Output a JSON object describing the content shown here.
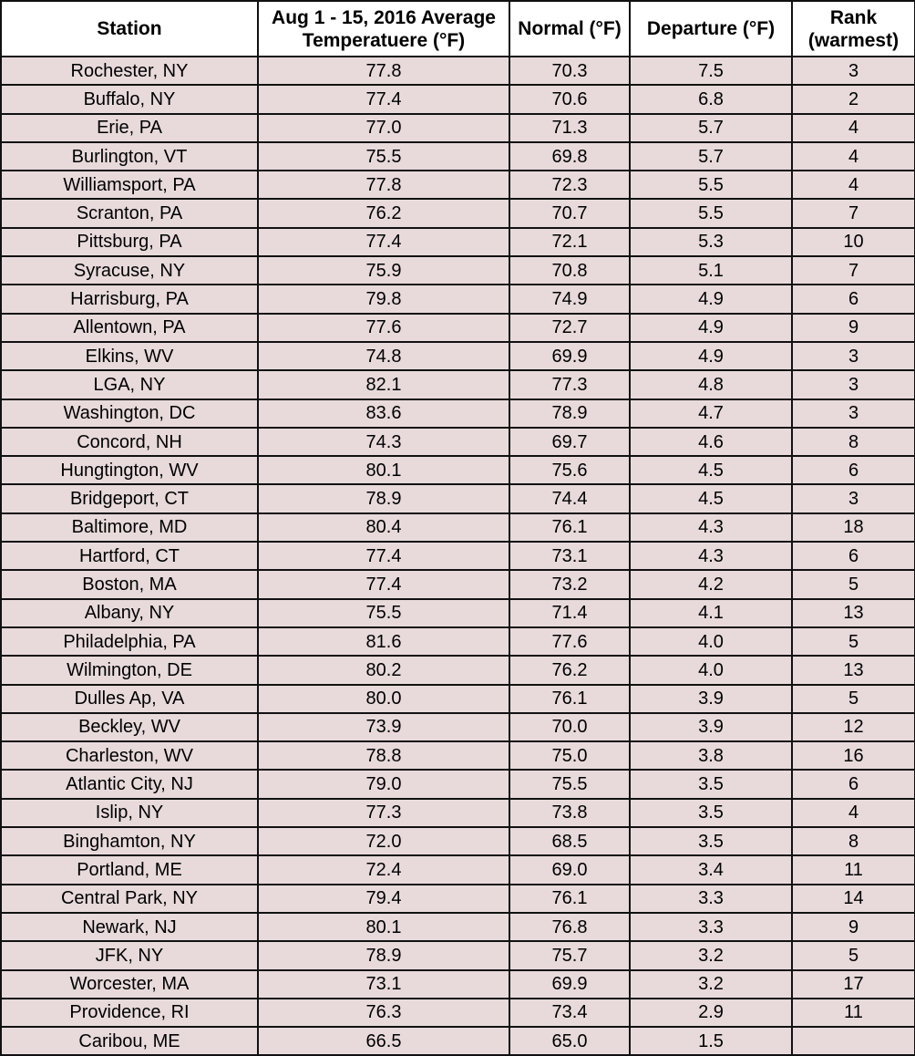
{
  "table": {
    "headers": [
      "Station",
      "Aug 1 - 15, 2016 Average Temperatuere (°F)",
      "Normal (°F)",
      "Departure (°F)",
      "Rank (warmest)"
    ],
    "header_lines": [
      [
        "Station"
      ],
      [
        "Aug 1 - 15, 2016 Average",
        "Temperatuere (°F)"
      ],
      [
        "Normal (°F)"
      ],
      [
        "Departure (°F)"
      ],
      [
        "Rank",
        "(warmest)"
      ]
    ],
    "rows": [
      [
        "Rochester, NY",
        "77.8",
        "70.3",
        "7.5",
        "3"
      ],
      [
        "Buffalo, NY",
        "77.4",
        "70.6",
        "6.8",
        "2"
      ],
      [
        "Erie, PA",
        "77.0",
        "71.3",
        "5.7",
        "4"
      ],
      [
        "Burlington, VT",
        "75.5",
        "69.8",
        "5.7",
        "4"
      ],
      [
        "Williamsport, PA",
        "77.8",
        "72.3",
        "5.5",
        "4"
      ],
      [
        "Scranton, PA",
        "76.2",
        "70.7",
        "5.5",
        "7"
      ],
      [
        "Pittsburg, PA",
        "77.4",
        "72.1",
        "5.3",
        "10"
      ],
      [
        "Syracuse, NY",
        "75.9",
        "70.8",
        "5.1",
        "7"
      ],
      [
        "Harrisburg, PA",
        "79.8",
        "74.9",
        "4.9",
        "6"
      ],
      [
        "Allentown, PA",
        "77.6",
        "72.7",
        "4.9",
        "9"
      ],
      [
        "Elkins, WV",
        "74.8",
        "69.9",
        "4.9",
        "3"
      ],
      [
        "LGA, NY",
        "82.1",
        "77.3",
        "4.8",
        "3"
      ],
      [
        "Washington, DC",
        "83.6",
        "78.9",
        "4.7",
        "3"
      ],
      [
        "Concord, NH",
        "74.3",
        "69.7",
        "4.6",
        "8"
      ],
      [
        "Hungtington, WV",
        "80.1",
        "75.6",
        "4.5",
        "6"
      ],
      [
        "Bridgeport, CT",
        "78.9",
        "74.4",
        "4.5",
        "3"
      ],
      [
        "Baltimore, MD",
        "80.4",
        "76.1",
        "4.3",
        "18"
      ],
      [
        "Hartford, CT",
        "77.4",
        "73.1",
        "4.3",
        "6"
      ],
      [
        "Boston, MA",
        "77.4",
        "73.2",
        "4.2",
        "5"
      ],
      [
        "Albany, NY",
        "75.5",
        "71.4",
        "4.1",
        "13"
      ],
      [
        "Philadelphia, PA",
        "81.6",
        "77.6",
        "4.0",
        "5"
      ],
      [
        "Wilmington, DE",
        "80.2",
        "76.2",
        "4.0",
        "13"
      ],
      [
        "Dulles Ap, VA",
        "80.0",
        "76.1",
        "3.9",
        "5"
      ],
      [
        "Beckley, WV",
        "73.9",
        "70.0",
        "3.9",
        "12"
      ],
      [
        "Charleston, WV",
        "78.8",
        "75.0",
        "3.8",
        "16"
      ],
      [
        "Atlantic City, NJ",
        "79.0",
        "75.5",
        "3.5",
        "6"
      ],
      [
        "Islip, NY",
        "77.3",
        "73.8",
        "3.5",
        "4"
      ],
      [
        "Binghamton, NY",
        "72.0",
        "68.5",
        "3.5",
        "8"
      ],
      [
        "Portland, ME",
        "72.4",
        "69.0",
        "3.4",
        "11"
      ],
      [
        "Central Park, NY",
        "79.4",
        "76.1",
        "3.3",
        "14"
      ],
      [
        "Newark, NJ",
        "80.1",
        "76.8",
        "3.3",
        "9"
      ],
      [
        "JFK, NY",
        "78.9",
        "75.7",
        "3.2",
        "5"
      ],
      [
        "Worcester, MA",
        "73.1",
        "69.9",
        "3.2",
        "17"
      ],
      [
        "Providence, RI",
        "76.3",
        "73.4",
        "2.9",
        "11"
      ],
      [
        "Caribou, ME",
        "66.5",
        "65.0",
        "1.5",
        ""
      ]
    ]
  },
  "colors": {
    "header_bg": "#ffffff",
    "row_bg": "#e8dadb",
    "border": "#111111",
    "text": "#000000"
  }
}
